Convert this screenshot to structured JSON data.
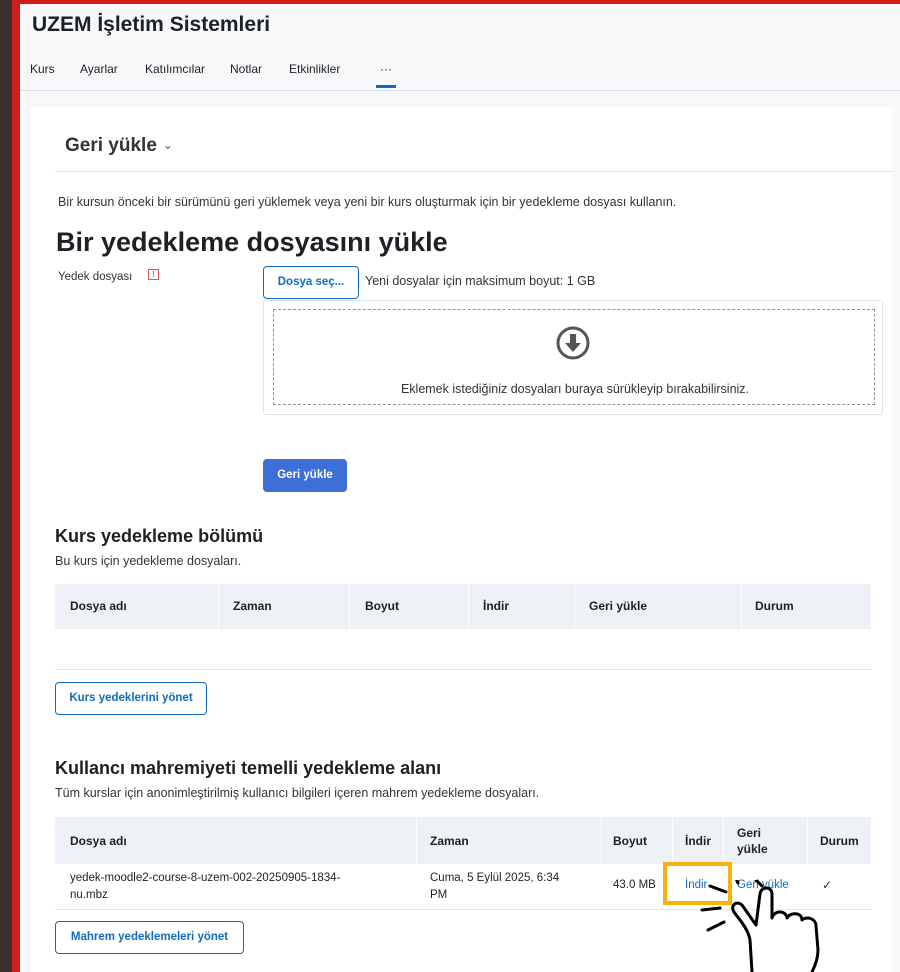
{
  "course": {
    "title": "UZEM İşletim Sistemleri"
  },
  "nav": {
    "tabs": [
      "Kurs",
      "Ayarlar",
      "Katılımcılar",
      "Notlar",
      "Etkinlikler",
      "···"
    ]
  },
  "region": {
    "title": "Geri yükle",
    "chevron": "⌄"
  },
  "intro": "Bir kursun önceki bir sürümünü geri yüklemek veya yeni bir kurs oluşturmak için bir yedekleme dosyası kullanın.",
  "upload": {
    "heading": "Bir yedekleme dosyasını yükle",
    "field_label": "Yedek dosyası",
    "required_icon": "!",
    "choose_button": "Dosya seç...",
    "max_size": "Yeni dosyalar için maksimum boyut: 1 GB",
    "drop_text": "Eklemek istediğiniz dosyaları buraya sürükleyip bırakabilirsiniz.",
    "restore_button": "Geri yükle"
  },
  "course_backups": {
    "heading": "Kurs yedekleme bölümü",
    "subtitle": "Bu kurs için yedekleme dosyaları.",
    "columns": [
      "Dosya adı",
      "Zaman",
      "Boyut",
      "İndir",
      "Geri yükle",
      "Durum"
    ],
    "manage_button": "Kurs yedeklerini yönet"
  },
  "private_backups": {
    "heading": "Kullancı mahremiyeti temelli yedekleme alanı",
    "subtitle": "Tüm kurslar için anonimleştirilmiş kullanıcı bilgileri içeren mahrem yedekleme dosyaları.",
    "columns": [
      "Dosya adı",
      "Zaman",
      "Boyut",
      "İndir",
      "Geri\nyükle",
      "Durum"
    ],
    "rows": [
      {
        "filename_line1": "yedek-moodle2-course-8-uzem-002-20250905-1834-",
        "filename_line2": "nu.mbz",
        "time_line1": "Cuma, 5 Eylül 2025, 6:34",
        "time_line2": "PM",
        "size": "43.0 MB",
        "download": "İndir",
        "restore": "Geri yükle",
        "status": "✓"
      }
    ],
    "manage_button": "Mahrem yedeklemeleri yönet"
  },
  "colors": {
    "accent": "#0f6cbf",
    "primary_button": "#3e6fd8",
    "highlight": "#f5b20a",
    "frame": "#d21b1b"
  }
}
